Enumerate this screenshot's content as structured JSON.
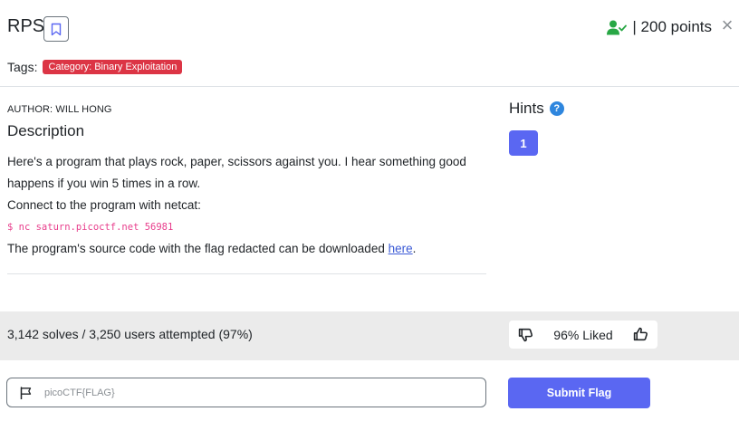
{
  "challenge": {
    "title": "RPS",
    "points": "| 200 points",
    "close_symbol": "×",
    "tags_label": "Tags:",
    "category": "Category: Binary Exploitation"
  },
  "description": {
    "author": "AUTHOR: WILL HONG",
    "heading": "Description",
    "para1": "Here's a program that plays rock, paper, scissors against you. I hear something good happens if you win 5 times in a row.",
    "para2": "Connect to the program with netcat:",
    "command": "$ nc saturn.picoctf.net 56981",
    "para3_prefix": "The program's source code with the flag redacted can be downloaded ",
    "para3_link": "here",
    "para3_suffix": "."
  },
  "hints": {
    "title": "Hints",
    "help_symbol": "?",
    "items": [
      "1"
    ]
  },
  "stats": {
    "solves_text": "3,142 solves / 3,250 users attempted (97%)",
    "liked_text": "96% Liked"
  },
  "flag_form": {
    "placeholder": "picoCTF{FLAG}",
    "submit_label": "Submit Flag"
  },
  "colors": {
    "accent": "#5a67f2",
    "category_badge": "#dc3545",
    "solved_icon": "#28a745",
    "help_icon": "#2e86de",
    "code": "#e83e8c"
  },
  "icons": {
    "bookmark": "bookmark-icon",
    "user_solved": "user-check-icon",
    "close": "close-icon",
    "help": "help-circle-icon",
    "thumbs_down": "thumbs-down-icon",
    "thumbs_up": "thumbs-up-icon",
    "flag": "flag-icon"
  }
}
